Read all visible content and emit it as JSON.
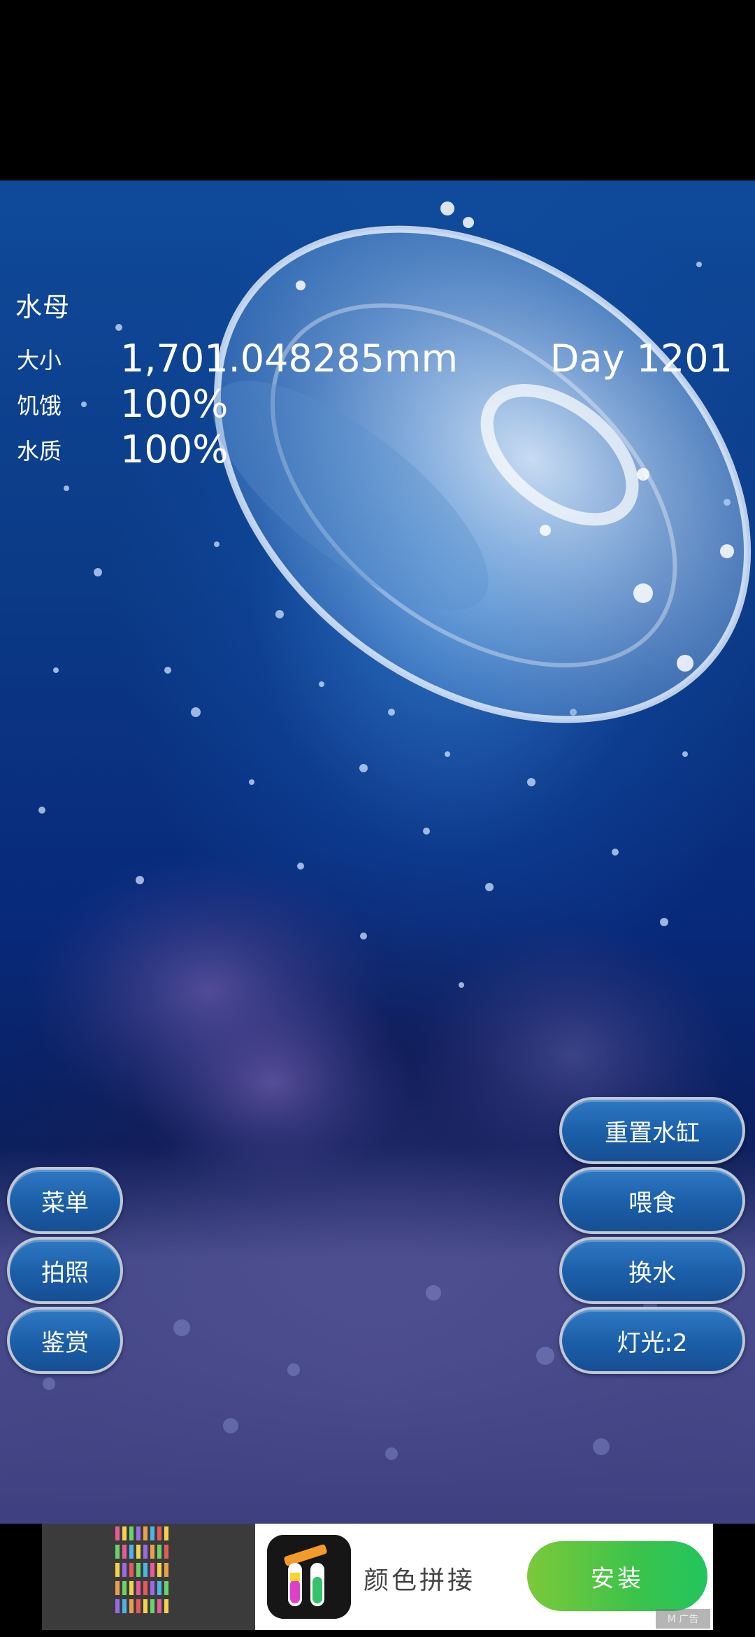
{
  "hud": {
    "creature_name": "水母",
    "size_label": "大小",
    "size_value": "1,701.048285mm",
    "day_text": "Day 1201",
    "hunger_label": "饥饿",
    "hunger_value": "100%",
    "water_label": "水质",
    "water_value": "100%"
  },
  "left_buttons": {
    "menu": "菜单",
    "photo": "拍照",
    "appreciate": "鉴赏"
  },
  "right_buttons": {
    "reset_tank": "重置水缸",
    "feed": "喂食",
    "change_water": "换水",
    "light": "灯光:2"
  },
  "ad": {
    "app_name": "颜色拼接",
    "install_label": "安装",
    "badge": "M 广告"
  },
  "colors": {
    "button_fill": "#1b5ea8",
    "button_border": "#bfc7d6",
    "install_green": "#3cc34a"
  }
}
